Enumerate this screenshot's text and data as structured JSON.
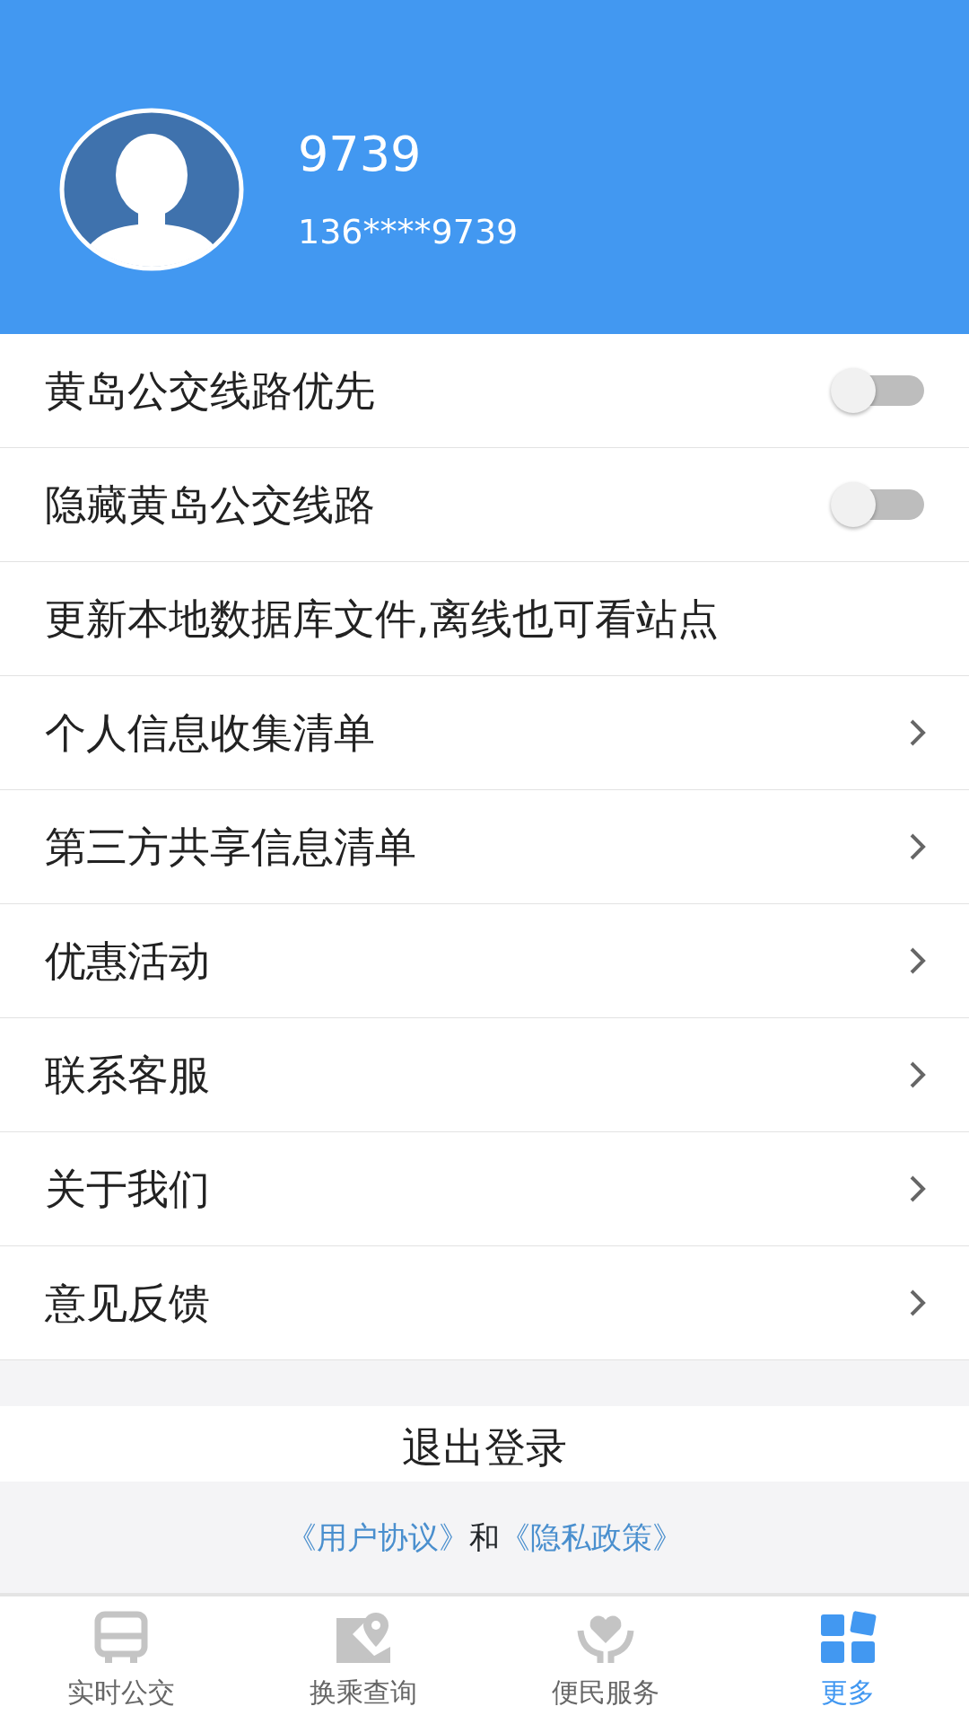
{
  "profile": {
    "name": "9739",
    "phone": "136****9739"
  },
  "settings": [
    {
      "kind": "toggle",
      "label": "黄岛公交线路优先",
      "on": false
    },
    {
      "kind": "toggle",
      "label": "隐藏黄岛公交线路",
      "on": false
    },
    {
      "kind": "plain",
      "label": "更新本地数据库文件,离线也可看站点"
    },
    {
      "kind": "link",
      "label": "个人信息收集清单"
    },
    {
      "kind": "link",
      "label": "第三方共享信息清单"
    },
    {
      "kind": "link",
      "label": "优惠活动"
    },
    {
      "kind": "link",
      "label": "联系客服"
    },
    {
      "kind": "link",
      "label": "关于我们"
    },
    {
      "kind": "link",
      "label": "意见反馈"
    }
  ],
  "logout_button": "退出登录",
  "agreement": {
    "user_agreement": "《用户协议》",
    "conjunction": "和",
    "privacy_policy": "《隐私政策》"
  },
  "tabs": [
    {
      "kind": "bus",
      "label": "实时公交",
      "selected": false
    },
    {
      "kind": "map",
      "label": "换乘查询",
      "selected": false
    },
    {
      "kind": "service",
      "label": "便民服务",
      "selected": false
    },
    {
      "kind": "more",
      "label": "更多",
      "selected": true
    }
  ]
}
